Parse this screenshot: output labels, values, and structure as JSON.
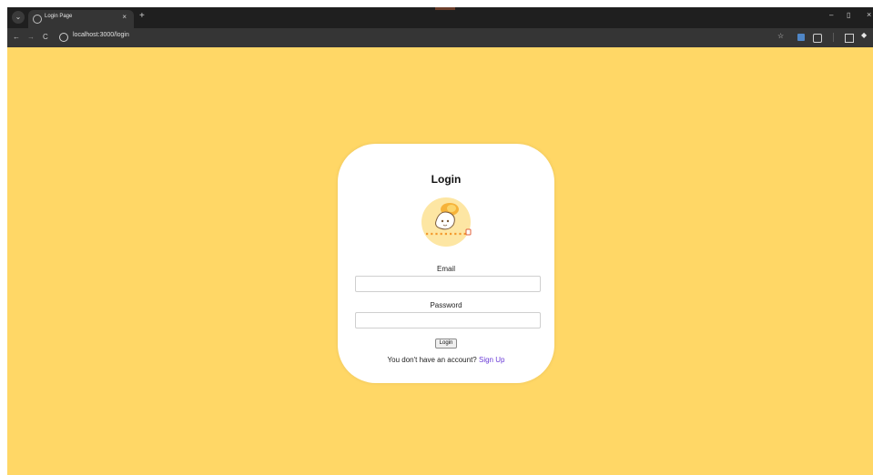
{
  "browser": {
    "tab": {
      "title": "Login Page",
      "close_glyph": "×"
    },
    "new_tab_glyph": "+",
    "window": {
      "minimize_glyph": "–",
      "maximize_glyph": "▯",
      "close_glyph": "×"
    },
    "nav": {
      "back": "←",
      "forward": "→",
      "reload": "C"
    },
    "url": "localhost:3000/login",
    "toolbar_icons": [
      "star-icon",
      "extension-icon",
      "puzzle-icon",
      "side-panel-icon",
      "profile-extension-icon"
    ]
  },
  "login": {
    "title": "Login",
    "email_label": "Email",
    "email_value": "",
    "password_label": "Password",
    "password_value": "",
    "button_label": "Login",
    "signup_prompt": "You don't have an account? ",
    "signup_link": "Sign Up"
  },
  "logo": {
    "name": "egg-mascot-logo"
  },
  "colors": {
    "page_background": "#ffd766",
    "card_background": "#ffffff",
    "link": "#6a3bd6",
    "logo_circle": "#fde6a3",
    "logo_accent": "#f39a2d"
  }
}
